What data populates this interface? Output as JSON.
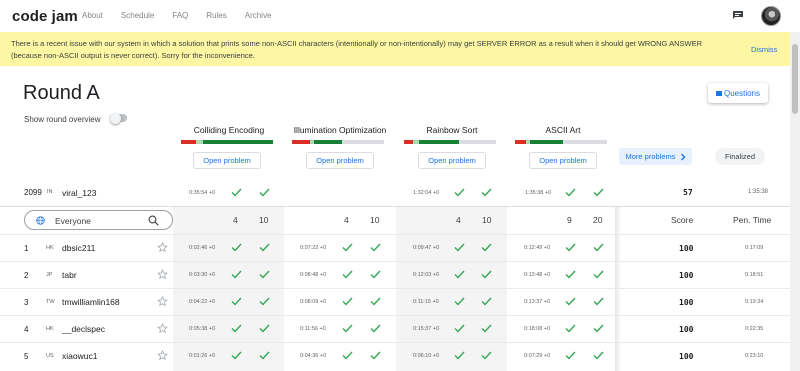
{
  "header": {
    "logo": "code jam",
    "nav": [
      "About",
      "Schedule",
      "FAQ",
      "Rules",
      "Archive"
    ]
  },
  "banner": {
    "text": "There is a recent issue with our system in which a solution that prints some non-ASCII characters (intentionally or non-intentionally) may get SERVER ERROR as a result when it should get WRONG ANSWER (because non-ASCII output is never correct). Sorry for the inconvenience.",
    "dismiss": "Dismiss"
  },
  "round": {
    "title": "Round A",
    "overview_label": "Show round overview",
    "questions_label": "Questions"
  },
  "problems": [
    {
      "name": "Colliding Encoding",
      "open": "Open problem"
    },
    {
      "name": "Illumination Optimization",
      "open": "Open problem"
    },
    {
      "name": "Rainbow Sort",
      "open": "Open problem"
    },
    {
      "name": "ASCII Art",
      "open": "Open problem"
    }
  ],
  "more_problems": "More problems",
  "finalized": "Finalized",
  "my_row": {
    "rank": "2099",
    "country": "IN",
    "user": "viral_123",
    "times": [
      "0:35:54 +0",
      "",
      "1:32:04 +0",
      "1:35:38 +0"
    ],
    "score": "57",
    "penalty": "1:35:38"
  },
  "scoreboard": {
    "filter": "Everyone",
    "points": [
      [
        "4",
        "10"
      ],
      [
        "4",
        "10"
      ],
      [
        "4",
        "10"
      ],
      [
        "9",
        "20"
      ]
    ],
    "score_header": "Score",
    "penalty_header": "Pen. Time",
    "rows": [
      {
        "rank": "1",
        "country": "HK",
        "user": "dbsic211",
        "times": [
          "0:02:46 +0",
          "0:07:22 +0",
          "0:09:47 +0",
          "0:12:49 +0"
        ],
        "score": "100",
        "penalty": "0:17:09"
      },
      {
        "rank": "2",
        "country": "JP",
        "user": "tabr",
        "times": [
          "0:03:30 +0",
          "0:08:48 +0",
          "0:12:03 +0",
          "0:13:48 +0"
        ],
        "score": "100",
        "penalty": "0:18:51"
      },
      {
        "rank": "3",
        "country": "TW",
        "user": "tmwilliamlin168",
        "times": [
          "0:04:22 +0",
          "0:08:09 +0",
          "0:11:15 +0",
          "0:13:37 +0"
        ],
        "score": "100",
        "penalty": "0:19:34"
      },
      {
        "rank": "4",
        "country": "HK",
        "user": "__declspec",
        "times": [
          "0:05:38 +0",
          "0:11:56 +0",
          "0:15:37 +0",
          "0:18:08 +0"
        ],
        "score": "100",
        "penalty": "0:22:35"
      },
      {
        "rank": "5",
        "country": "US",
        "user": "xiaowuc1",
        "times": [
          "0:01:26 +0",
          "0:04:36 +0",
          "0:06:10 +0",
          "0:07:29 +0"
        ],
        "score": "100",
        "penalty": "0:23:10"
      }
    ]
  },
  "colors": {
    "accent": "#1a73e8",
    "check": "#34a853",
    "bar_red": "#d93025",
    "bar_green": "#188038",
    "bar_light_green": "#a8dab5",
    "bar_gray": "#dadce0",
    "banner": "#fdf6a3"
  },
  "icons": {
    "chat": "chat-icon",
    "search": "search-icon",
    "globe": "globe-icon",
    "star": "star-outline-icon",
    "check": "check-icon",
    "chevron": "chevron-right-icon"
  },
  "progress": [
    {
      "red": 0.16,
      "light": 0.08,
      "green": 0.76,
      "gray": 0.0
    },
    {
      "red": 0.2,
      "light": 0.04,
      "green": 0.3,
      "gray": 0.46
    },
    {
      "red": 0.1,
      "light": 0.06,
      "green": 0.44,
      "gray": 0.4
    },
    {
      "red": 0.12,
      "light": 0.04,
      "green": 0.36,
      "gray": 0.48
    }
  ]
}
